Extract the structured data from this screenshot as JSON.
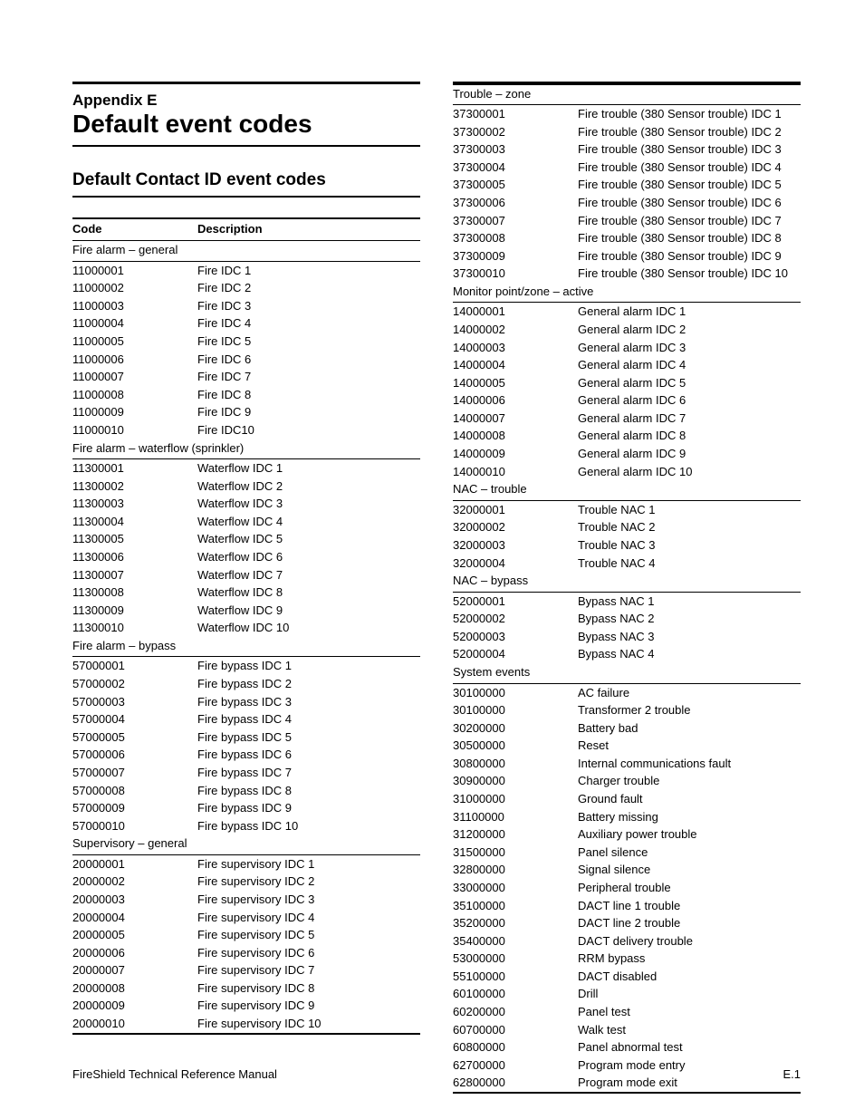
{
  "header": {
    "appendix": "Appendix E",
    "title": "Default event codes",
    "subheading": "Default Contact ID event codes"
  },
  "table_headers": {
    "code": "Code",
    "description": "Description"
  },
  "left_sections": [
    {
      "title": "Fire alarm – general",
      "rows": [
        [
          "11000001",
          "Fire IDC 1"
        ],
        [
          "11000002",
          "Fire IDC 2"
        ],
        [
          "11000003",
          "Fire IDC 3"
        ],
        [
          "11000004",
          "Fire IDC 4"
        ],
        [
          "11000005",
          "Fire IDC 5"
        ],
        [
          "11000006",
          "Fire IDC 6"
        ],
        [
          "11000007",
          "Fire IDC 7"
        ],
        [
          "11000008",
          "Fire IDC 8"
        ],
        [
          "11000009",
          "Fire IDC 9"
        ],
        [
          "11000010",
          "Fire IDC10"
        ]
      ]
    },
    {
      "title": "Fire alarm – waterflow (sprinkler)",
      "rows": [
        [
          "11300001",
          "Waterflow IDC 1"
        ],
        [
          "11300002",
          "Waterflow IDC 2"
        ],
        [
          "11300003",
          "Waterflow IDC 3"
        ],
        [
          "11300004",
          "Waterflow IDC 4"
        ],
        [
          "11300005",
          "Waterflow IDC 5"
        ],
        [
          "11300006",
          "Waterflow IDC 6"
        ],
        [
          "11300007",
          "Waterflow IDC 7"
        ],
        [
          "11300008",
          "Waterflow IDC 8"
        ],
        [
          "11300009",
          "Waterflow IDC 9"
        ],
        [
          "11300010",
          "Waterflow IDC 10"
        ]
      ]
    },
    {
      "title": "Fire alarm – bypass",
      "rows": [
        [
          "57000001",
          "Fire bypass IDC 1"
        ],
        [
          "57000002",
          "Fire bypass IDC 2"
        ],
        [
          "57000003",
          "Fire bypass IDC 3"
        ],
        [
          "57000004",
          "Fire bypass IDC 4"
        ],
        [
          "57000005",
          "Fire bypass IDC 5"
        ],
        [
          "57000006",
          "Fire bypass IDC 6"
        ],
        [
          "57000007",
          "Fire bypass IDC 7"
        ],
        [
          "57000008",
          "Fire bypass IDC 8"
        ],
        [
          "57000009",
          "Fire bypass IDC 9"
        ],
        [
          "57000010",
          "Fire bypass IDC 10"
        ]
      ]
    },
    {
      "title": "Supervisory – general",
      "rows": [
        [
          "20000001",
          "Fire supervisory IDC 1"
        ],
        [
          "20000002",
          "Fire supervisory IDC 2"
        ],
        [
          "20000003",
          "Fire supervisory IDC 3"
        ],
        [
          "20000004",
          "Fire supervisory IDC 4"
        ],
        [
          "20000005",
          "Fire supervisory IDC 5"
        ],
        [
          "20000006",
          "Fire supervisory IDC 6"
        ],
        [
          "20000007",
          "Fire supervisory IDC 7"
        ],
        [
          "20000008",
          "Fire supervisory IDC 8"
        ],
        [
          "20000009",
          "Fire supervisory IDC 9"
        ],
        [
          "20000010",
          "Fire supervisory IDC 10"
        ]
      ]
    }
  ],
  "right_sections": [
    {
      "title": "Trouble – zone",
      "rows": [
        [
          "37300001",
          "Fire trouble (380 Sensor trouble) IDC 1"
        ],
        [
          "37300002",
          "Fire trouble (380 Sensor trouble) IDC 2"
        ],
        [
          "37300003",
          "Fire trouble (380 Sensor trouble) IDC 3"
        ],
        [
          "37300004",
          "Fire trouble (380 Sensor trouble) IDC 4"
        ],
        [
          "37300005",
          "Fire trouble (380 Sensor trouble) IDC 5"
        ],
        [
          "37300006",
          "Fire trouble (380 Sensor trouble) IDC 6"
        ],
        [
          "37300007",
          "Fire trouble (380 Sensor trouble) IDC 7"
        ],
        [
          "37300008",
          "Fire trouble (380 Sensor trouble) IDC 8"
        ],
        [
          "37300009",
          "Fire trouble (380 Sensor trouble) IDC 9"
        ],
        [
          "37300010",
          "Fire trouble (380 Sensor trouble) IDC 10"
        ]
      ]
    },
    {
      "title": "Monitor point/zone – active",
      "rows": [
        [
          "14000001",
          "General alarm IDC 1"
        ],
        [
          "14000002",
          "General alarm IDC 2"
        ],
        [
          "14000003",
          "General alarm IDC 3"
        ],
        [
          "14000004",
          "General alarm IDC 4"
        ],
        [
          "14000005",
          "General alarm IDC 5"
        ],
        [
          "14000006",
          "General alarm IDC 6"
        ],
        [
          "14000007",
          "General alarm IDC 7"
        ],
        [
          "14000008",
          "General alarm IDC 8"
        ],
        [
          "14000009",
          "General alarm IDC 9"
        ],
        [
          "14000010",
          "General alarm IDC 10"
        ]
      ]
    },
    {
      "title": "NAC – trouble",
      "rows": [
        [
          "32000001",
          "Trouble NAC 1"
        ],
        [
          "32000002",
          "Trouble NAC 2"
        ],
        [
          "32000003",
          "Trouble NAC 3"
        ],
        [
          "32000004",
          "Trouble NAC 4"
        ]
      ]
    },
    {
      "title": "NAC – bypass",
      "rows": [
        [
          "52000001",
          "Bypass NAC 1"
        ],
        [
          "52000002",
          "Bypass NAC 2"
        ],
        [
          "52000003",
          "Bypass NAC 3"
        ],
        [
          "52000004",
          "Bypass NAC 4"
        ]
      ]
    },
    {
      "title": "System events",
      "rows": [
        [
          "30100000",
          "AC failure"
        ],
        [
          "30100000",
          "Transformer 2 trouble"
        ],
        [
          "30200000",
          "Battery bad"
        ],
        [
          "30500000",
          "Reset"
        ],
        [
          "30800000",
          "Internal communications fault"
        ],
        [
          "30900000",
          "Charger trouble"
        ],
        [
          "31000000",
          "Ground fault"
        ],
        [
          "31100000",
          "Battery missing"
        ],
        [
          "31200000",
          "Auxiliary power trouble"
        ],
        [
          "31500000",
          "Panel silence"
        ],
        [
          "32800000",
          "Signal silence"
        ],
        [
          "33000000",
          "Peripheral trouble"
        ],
        [
          "35100000",
          "DACT line 1 trouble"
        ],
        [
          "35200000",
          "DACT line 2 trouble"
        ],
        [
          "35400000",
          "DACT delivery trouble"
        ],
        [
          "53000000",
          "RRM bypass"
        ],
        [
          "55100000",
          "DACT disabled"
        ],
        [
          "60100000",
          "Drill"
        ],
        [
          "60200000",
          "Panel test"
        ],
        [
          "60700000",
          "Walk test"
        ],
        [
          "60800000",
          "Panel abnormal test"
        ],
        [
          "62700000",
          "Program mode entry"
        ],
        [
          "62800000",
          "Program mode exit"
        ]
      ]
    }
  ],
  "footer": {
    "left": "FireShield Technical Reference Manual",
    "right": "E.1"
  }
}
